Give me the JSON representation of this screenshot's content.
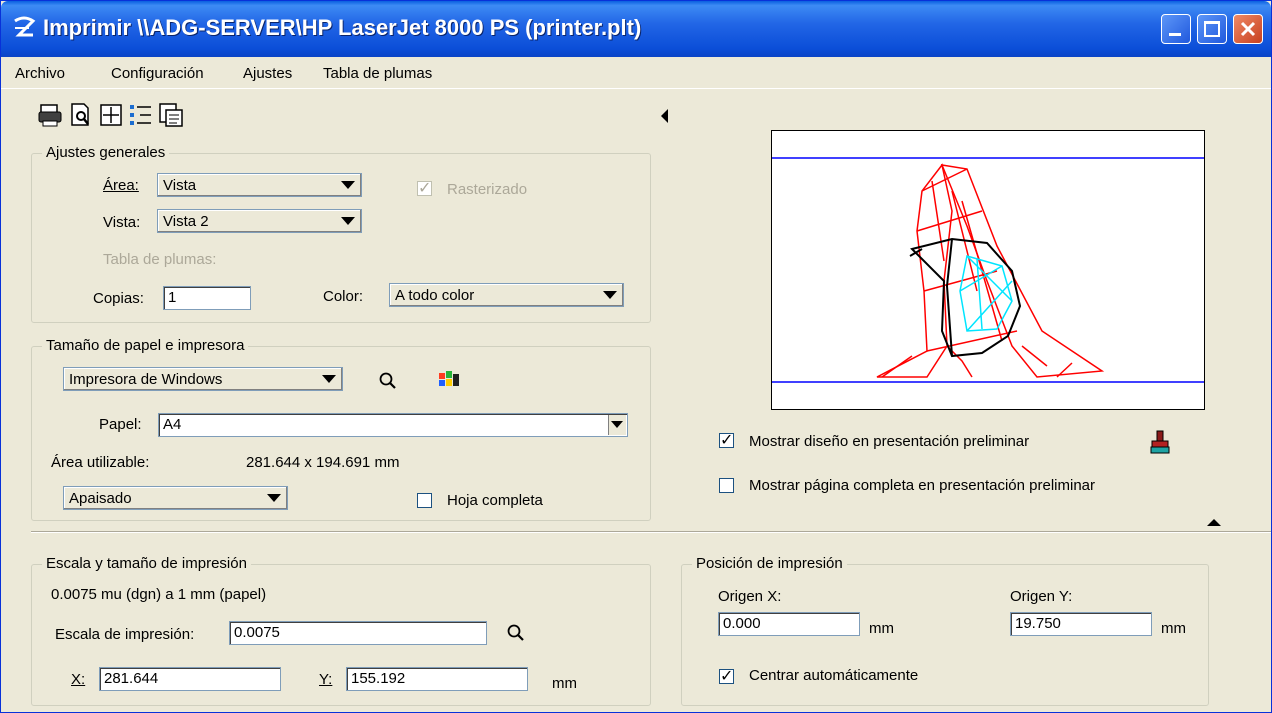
{
  "window": {
    "title": "Imprimir  \\\\ADG-SERVER\\HP LaserJet 8000 PS  (printer.plt)"
  },
  "menu": {
    "items": [
      "Archivo",
      "Configuración",
      "Ajustes",
      "Tabla de plumas"
    ]
  },
  "toolbar": {
    "icons": [
      "printer-icon",
      "print-preview-icon",
      "fit-view-icon",
      "list-icon",
      "pen-table-icon"
    ]
  },
  "general": {
    "legend": "Ajustes generales",
    "area_label": "Área:",
    "area_value": "Vista",
    "rasterizado_label": "Rasterizado",
    "rasterizado_checked": true,
    "vista_label": "Vista:",
    "vista_value": "Vista 2",
    "pen_table_label": "Tabla de plumas:",
    "copies_label": "Copias:",
    "copies_value": "1",
    "color_label": "Color:",
    "color_value": "A todo color"
  },
  "paper": {
    "legend": "Tamaño de papel e impresora",
    "printer_value": "Impresora de Windows",
    "paper_label": "Papel:",
    "paper_value": "A4",
    "usable_label": "Área utilizable:",
    "usable_value": "281.644 x 194.691 mm",
    "orientation_value": "Apaisado",
    "full_sheet_label": "Hoja completa",
    "full_sheet_checked": false
  },
  "preview": {
    "show_design_label": "Mostrar diseño en presentación preliminar",
    "show_design_checked": true,
    "show_full_page_label": "Mostrar página completa en presentación preliminar",
    "show_full_page_checked": false
  },
  "scale": {
    "legend": "Escala y tamaño de impresión",
    "ratio_text": "0.0075 mu (dgn) a 1 mm (papel)",
    "scale_label": "Escala de impresión:",
    "scale_value": "0.0075",
    "x_label": "X:",
    "x_value": "281.644",
    "y_label": "Y:",
    "y_value": "155.192",
    "unit": "mm"
  },
  "position": {
    "legend": "Posición de impresión",
    "origin_x_label": "Origen X:",
    "origin_x_value": "0.000",
    "origin_y_label": "Origen Y:",
    "origin_y_value": "19.750",
    "unit": "mm",
    "auto_center_label": "Centrar automáticamente",
    "auto_center_checked": true
  },
  "colors": {
    "title_bar": "#0b4ed8",
    "dialog_bg": "#ece9d8",
    "preview_red": "#ff0000",
    "preview_cyan": "#00e5ff",
    "preview_blue_line": "#0000ff"
  }
}
